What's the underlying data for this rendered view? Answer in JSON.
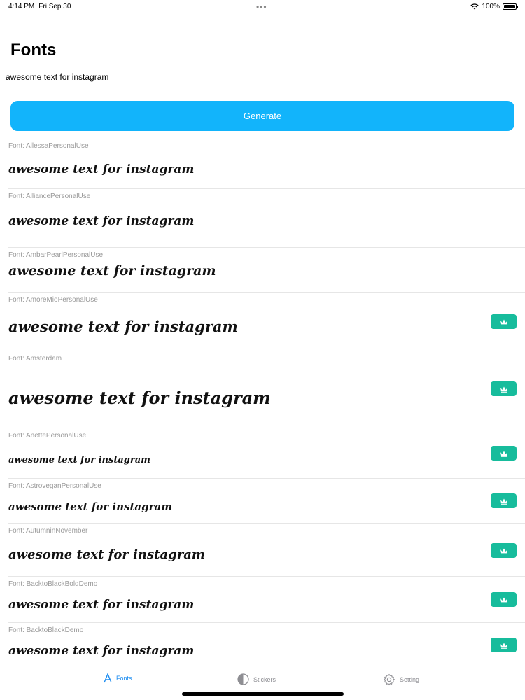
{
  "status": {
    "time": "4:14 PM",
    "date": "Fri Sep 30",
    "dots": "•••",
    "battery": "100%"
  },
  "header": {
    "title": "Fonts"
  },
  "input": {
    "value": "awesome text for instagram"
  },
  "generate_label": "Generate",
  "fonts": [
    {
      "label": "Font: AllessaPersonalUse",
      "sample": "awesome text for instagram",
      "premium": false
    },
    {
      "label": "Font: AlliancePersonalUse",
      "sample": "awesome text for instagram",
      "premium": false
    },
    {
      "label": "Font: AmbarPearlPersonalUse",
      "sample": "awesome text for instagram",
      "premium": false
    },
    {
      "label": "Font: AmoreMioPersonalUse",
      "sample": "awesome text for instagram",
      "premium": true
    },
    {
      "label": "Font: Amsterdam",
      "sample": "awesome text for instagram",
      "premium": true
    },
    {
      "label": "Font: AnettePersonalUse",
      "sample": "awesome text for instagram",
      "premium": true
    },
    {
      "label": "Font: AstroveganPersonalUse",
      "sample": "awesome text for instagram",
      "premium": true
    },
    {
      "label": "Font: AutumninNovember",
      "sample": "awesome text for instagram",
      "premium": true
    },
    {
      "label": "Font: BacktoBlackBoldDemo",
      "sample": "awesome text for instagram",
      "premium": true
    },
    {
      "label": "Font: BacktoBlackDemo",
      "sample": "awesome text for instagram",
      "premium": true
    }
  ],
  "tabs": [
    {
      "label": "Fonts",
      "icon": "font-letter-icon",
      "active": true
    },
    {
      "label": "Stickers",
      "icon": "half-circle-icon",
      "active": false
    },
    {
      "label": "Setting",
      "icon": "gear-icon",
      "active": false
    }
  ],
  "colors": {
    "accent": "#12b4fb",
    "premium": "#17bc9c",
    "tab_active": "#1a8bf0"
  }
}
